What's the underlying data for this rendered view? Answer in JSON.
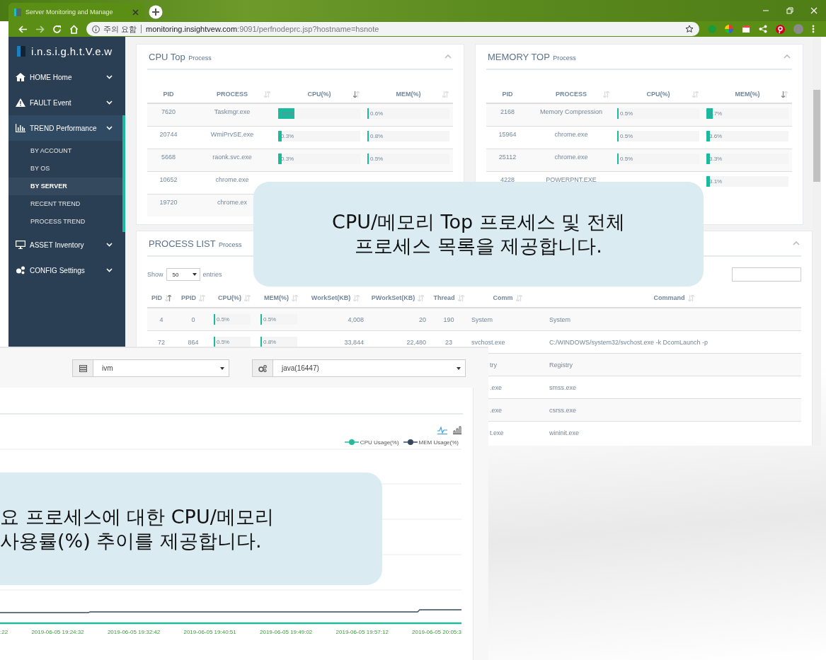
{
  "browser": {
    "tab_title": "Server Monitoring and Manage",
    "security_label": "주의 요함",
    "url_host": "monitoring.insightvew.com",
    "url_path": ":9091/perfnodeprc.jsp?hostname=hsnote"
  },
  "sidebar": {
    "logo": "i.n.s.i.g.h.t.V.e.w",
    "items": [
      {
        "label": "HOME Home",
        "selected": false
      },
      {
        "label": "FAULT Event",
        "selected": false
      },
      {
        "label": "TREND Performance",
        "selected": true,
        "children": [
          {
            "label": "BY ACCOUNT",
            "selected": false
          },
          {
            "label": "BY OS",
            "selected": false
          },
          {
            "label": "BY SERVER",
            "selected": true
          },
          {
            "label": "RECENT TREND",
            "selected": false
          },
          {
            "label": "PROCESS TREND",
            "selected": false
          }
        ]
      },
      {
        "label": "ASSET Inventory",
        "selected": false
      },
      {
        "label": "CONFIG Settings",
        "selected": false
      }
    ]
  },
  "cpu_top": {
    "title": "CPU Top",
    "subtitle": "Process",
    "columns": [
      {
        "label": "PID",
        "kind": "plain"
      },
      {
        "label": "PROCESS",
        "kind": "sortable"
      },
      {
        "label": "CPU(%)",
        "kind": "descending"
      },
      {
        "label": "MEM(%)",
        "kind": "sortable"
      }
    ],
    "rows": [
      {
        "pid": "7620",
        "process": "Taskmgr.exe",
        "cpu": {
          "text": "3.0%",
          "level": 0.2
        },
        "mem": {
          "text": "0.6%",
          "level": 0.02
        }
      },
      {
        "pid": "20744",
        "process": "WmiPrvSE.exe",
        "cpu": {
          "text": "0.3%",
          "level": 0.04
        },
        "mem": {
          "text": "0.8%",
          "level": 0.02
        }
      },
      {
        "pid": "5668",
        "process": "raonk.svc.exe",
        "cpu": {
          "text": "0.3%",
          "level": 0.04
        },
        "mem": {
          "text": "0.5%",
          "level": 0.02
        }
      },
      {
        "pid": "10652",
        "process": "chrome.exe"
      },
      {
        "pid": "19720",
        "process": "chrome.ex"
      }
    ]
  },
  "memory_top": {
    "title": "MEMORY TOP",
    "subtitle": "Process",
    "columns": [
      {
        "label": "PID",
        "kind": "plain"
      },
      {
        "label": "PROCESS",
        "kind": "sortable"
      },
      {
        "label": "CPU(%)",
        "kind": "sortable"
      },
      {
        "label": "MEM(%)",
        "kind": "descending"
      }
    ],
    "rows": [
      {
        "pid": "2168",
        "process": "Memory Compression",
        "cpu": {
          "text": "0.5%",
          "level": 0.02
        },
        "mem": {
          "text": "7.7%",
          "level": 0.08
        }
      },
      {
        "pid": "15964",
        "process": "chrome.exe",
        "cpu": {
          "text": "0.5%",
          "level": 0.02
        },
        "mem": {
          "text": "3.6%",
          "level": 0.04
        }
      },
      {
        "pid": "25112",
        "process": "chrome.exe",
        "cpu": {
          "text": "0.5%",
          "level": 0.02
        },
        "mem": {
          "text": "3.3%",
          "level": 0.04
        }
      },
      {
        "pid": "4228",
        "process": "POWERPNT.EXE",
        "mem": {
          "text": "3.1%",
          "level": 0.04
        }
      }
    ]
  },
  "process_list": {
    "title": "PROCESS LIST",
    "subtitle": "Process",
    "show_label": "Show",
    "page_size": "50",
    "entries_label": "entries",
    "columns": [
      {
        "label": "PID",
        "kind": "ascending"
      },
      {
        "label": "PPID",
        "kind": "sortable"
      },
      {
        "label": "CPU(%)",
        "kind": "sortable"
      },
      {
        "label": "MEM(%)",
        "kind": "sortable"
      },
      {
        "label": "WorkSet(KB)",
        "kind": "sortable"
      },
      {
        "label": "PWorkSet(KB)",
        "kind": "sortable"
      },
      {
        "label": "Thread",
        "kind": "sortable"
      },
      {
        "label": "Comm",
        "kind": "sortable"
      },
      {
        "label": "Command",
        "kind": "sortable"
      }
    ],
    "rows": [
      {
        "pid": "4",
        "ppid": "0",
        "cpu": {
          "text": "0.5%",
          "level": 0.04
        },
        "mem": {
          "text": "0.5%",
          "level": 0.04
        },
        "workset": "4,008",
        "pworkset": "20",
        "thread": "190",
        "comm": "System",
        "command": "System"
      },
      {
        "pid": "72",
        "ppid": "864",
        "cpu": {
          "text": "0.5%",
          "level": 0.04
        },
        "mem": {
          "text": "0.8%",
          "level": 0.04
        },
        "workset": "33,844",
        "pworkset": "22,480",
        "thread": "23",
        "comm": "svchost.exe",
        "command": "C:/WINDOWS/system32/svchost.exe -k DcomLaunch -p"
      },
      {
        "comm": "try",
        "command": "Registry"
      },
      {
        "comm": ".exe",
        "command": "smss.exe"
      },
      {
        "comm": ".exe",
        "command": "csrss.exe"
      },
      {
        "comm": "t.exe",
        "command": "wininit.exe"
      }
    ]
  },
  "trend_panel": {
    "server_select": "ivm",
    "process_select": "java(16447)",
    "legend": [
      {
        "label": "CPU Usage(%)",
        "color": "#26b99a"
      },
      {
        "label": "MEM Usage(%)",
        "color": "#34495e"
      }
    ],
    "x_labels": [
      ":22",
      "2019-06-05 19:24:32",
      "2019-06-05 19:32:42",
      "2019-06-05 19:40:51",
      "2019-06-05 19:49:02",
      "2019-06-05 19:57:12",
      "2019-06-05 20:05:3"
    ]
  },
  "callouts": [
    {
      "kind": "top",
      "lines": [
        "CPU/메모리 Top 프로세스 및 전체",
        "프로세스 목록을 제공합니다."
      ]
    },
    {
      "kind": "bottom",
      "lines": [
        "요 프로세스에 대한 CPU/메모리",
        "사용률(%) 추이를 제공합니다."
      ]
    }
  ]
}
